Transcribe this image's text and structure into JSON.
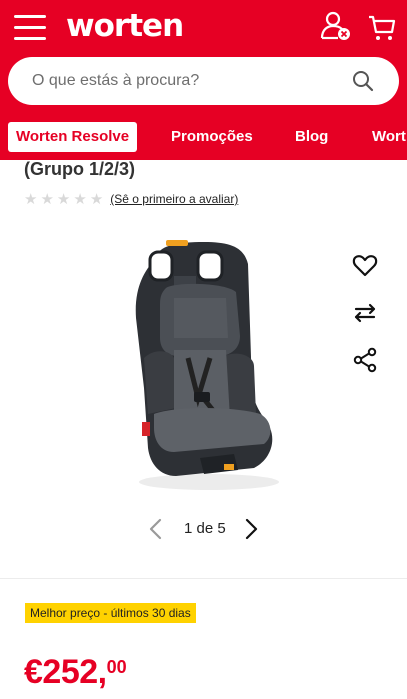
{
  "header": {
    "logo": "worten",
    "search_placeholder": "O que estás à procura?",
    "colors": {
      "brand": "#e60024",
      "badge": "#ffd200"
    }
  },
  "nav": {
    "tabs": [
      {
        "label": "Worten Resolve"
      },
      {
        "label": "Promoções"
      },
      {
        "label": "Blog"
      },
      {
        "label": "Wort"
      }
    ]
  },
  "product": {
    "title_line": "(Grupo 1/2/3)",
    "rating_text": "(Sê o primeiro a avaliar)",
    "image_icon": "car-seat-image",
    "pager": {
      "text": "1 de 5"
    },
    "badge": "Melhor preço - últimos 30 dias",
    "price_int": "€252,",
    "price_dec": "00"
  },
  "icons": [
    "menu-icon",
    "user-icon",
    "cart-icon",
    "search-icon",
    "heart-icon",
    "compare-icon",
    "share-icon",
    "chevron-left-icon",
    "chevron-right-icon",
    "star-icon"
  ]
}
